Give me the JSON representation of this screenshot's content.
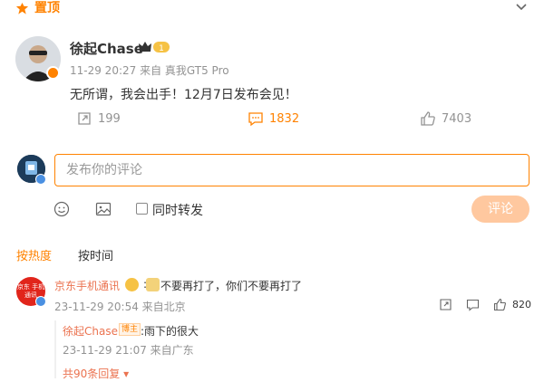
{
  "pin": {
    "label": "置顶"
  },
  "post": {
    "author": "徐起Chase",
    "meta": "11-29 20:27 来自 真我GT5 Pro",
    "text": "无所谓，我会出手！12月7日发布会见！",
    "repost_count": "199",
    "comment_count": "1832",
    "like_count": "7403"
  },
  "composer": {
    "placeholder": "发布你的评论",
    "repost_label": "同时转发",
    "submit_label": "评论"
  },
  "sort": {
    "hot": "按热度",
    "time": "按时间"
  },
  "comment": {
    "author": "京东手机通讯",
    "avatar_text": "京东 手机通讯",
    "text_prefix": ":",
    "text": "不要再打了，你们不要再打了",
    "meta": "23-11-29 20:54 来自北京",
    "likes": "820",
    "reply": {
      "author": "徐起Chase",
      "tag": "博主",
      "text": ":雨下的很大",
      "meta": "23-11-29 21:07 来自广东"
    },
    "more_label": "共90条回复 ▾"
  },
  "colors": {
    "accent": "#ff8200",
    "link": "#eb7350",
    "muted": "#939393"
  }
}
